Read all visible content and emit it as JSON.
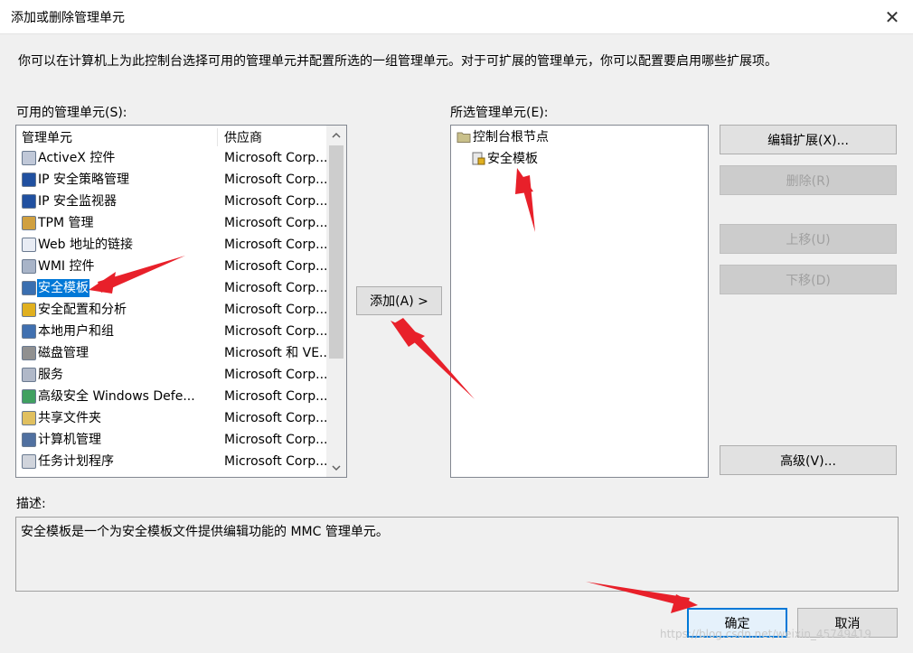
{
  "window": {
    "title": "添加或删除管理单元"
  },
  "intro": "你可以在计算机上为此控制台选择可用的管理单元并配置所选的一组管理单元。对于可扩展的管理单元，你可以配置要启用哪些扩展项。",
  "available": {
    "label": "可用的管理单元(S):",
    "col_name": "管理单元",
    "col_vendor": "供应商",
    "items": [
      {
        "name": "ActiveX 控件",
        "vendor": "Microsoft Corp...",
        "icon": "activex-icon"
      },
      {
        "name": "IP 安全策略管理",
        "vendor": "Microsoft Corp...",
        "icon": "ip-security-policy-icon"
      },
      {
        "name": "IP 安全监视器",
        "vendor": "Microsoft Corp...",
        "icon": "ip-security-monitor-icon"
      },
      {
        "name": "TPM 管理",
        "vendor": "Microsoft Corp...",
        "icon": "tpm-icon"
      },
      {
        "name": "Web 地址的链接",
        "vendor": "Microsoft Corp...",
        "icon": "web-link-icon"
      },
      {
        "name": "WMI 控件",
        "vendor": "Microsoft Corp...",
        "icon": "wmi-icon"
      },
      {
        "name": "安全模板",
        "vendor": "Microsoft Corp...",
        "icon": "security-template-icon",
        "selected": true
      },
      {
        "name": "安全配置和分析",
        "vendor": "Microsoft Corp...",
        "icon": "security-config-icon"
      },
      {
        "name": "本地用户和组",
        "vendor": "Microsoft Corp...",
        "icon": "users-groups-icon"
      },
      {
        "name": "磁盘管理",
        "vendor": "Microsoft 和 VE...",
        "icon": "disk-icon"
      },
      {
        "name": "服务",
        "vendor": "Microsoft Corp...",
        "icon": "services-gear-icon"
      },
      {
        "name": "高级安全 Windows Defe...",
        "vendor": "Microsoft Corp...",
        "icon": "firewall-icon"
      },
      {
        "name": "共享文件夹",
        "vendor": "Microsoft Corp...",
        "icon": "shared-folder-icon"
      },
      {
        "name": "计算机管理",
        "vendor": "Microsoft Corp...",
        "icon": "computer-management-icon"
      },
      {
        "name": "任务计划程序",
        "vendor": "Microsoft Corp...",
        "icon": "task-scheduler-icon"
      }
    ]
  },
  "add_button": "添加(A) >",
  "selected": {
    "label": "所选管理单元(E):",
    "root": "控制台根节点",
    "child": "安全模板"
  },
  "buttons": {
    "edit_ext": "编辑扩展(X)...",
    "remove": "删除(R)",
    "move_up": "上移(U)",
    "move_down": "下移(D)",
    "advanced": "高级(V)...",
    "ok": "确定",
    "cancel": "取消"
  },
  "description": {
    "label": "描述:",
    "text": "安全模板是一个为安全模板文件提供编辑功能的 MMC 管理单元。"
  },
  "close_glyph": "✕",
  "watermark": "https://blog.csdn.net/weixin_45749419",
  "colors": {
    "selection": "#0078d7",
    "annotation_arrow": "#e8202a"
  }
}
